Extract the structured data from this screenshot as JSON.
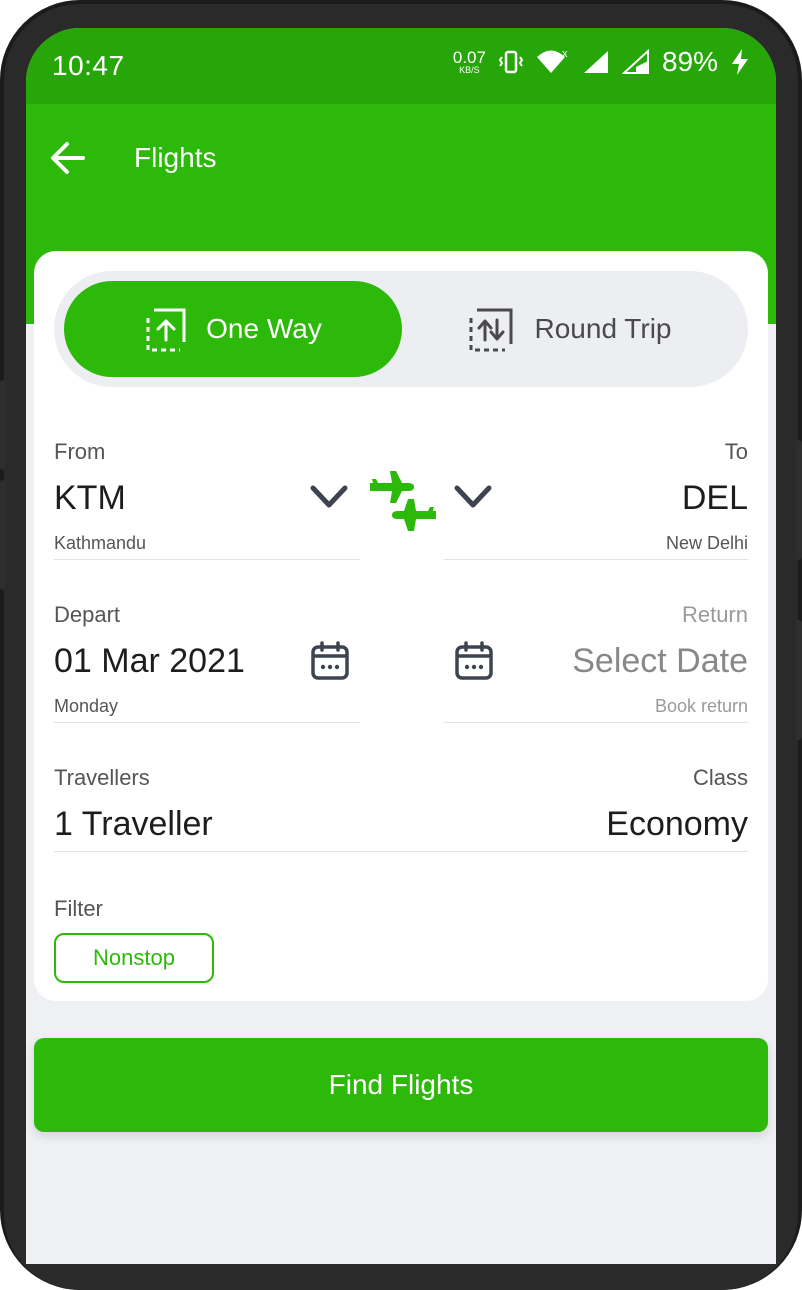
{
  "status": {
    "time": "10:47",
    "speed_value": "0.07",
    "speed_unit": "KB/S",
    "battery": "89%"
  },
  "appbar": {
    "title": "Flights"
  },
  "trip_type": {
    "one_way": "One Way",
    "round_trip": "Round Trip",
    "selected": "One Way"
  },
  "from": {
    "label": "From",
    "code": "KTM",
    "city": "Kathmandu"
  },
  "to": {
    "label": "To",
    "code": "DEL",
    "city": "New Delhi"
  },
  "depart": {
    "label": "Depart",
    "date": "01 Mar 2021",
    "day": "Monday"
  },
  "return": {
    "label": "Return",
    "value": "Select Date",
    "hint": "Book return"
  },
  "travellers": {
    "label": "Travellers",
    "value": "1 Traveller"
  },
  "class": {
    "label": "Class",
    "value": "Economy"
  },
  "filter": {
    "label": "Filter",
    "chip": "Nonstop"
  },
  "actions": {
    "find": "Find Flights"
  },
  "colors": {
    "accent": "#2cb90a",
    "status_bar": "#26a608",
    "background": "#eef0f3"
  },
  "icons": [
    "back-arrow-icon",
    "vibrate-icon",
    "wifi-icon",
    "signal-icon",
    "battery-charging-icon",
    "one-way-icon",
    "round-trip-icon",
    "chevron-down-icon",
    "swap-planes-icon",
    "calendar-icon"
  ]
}
